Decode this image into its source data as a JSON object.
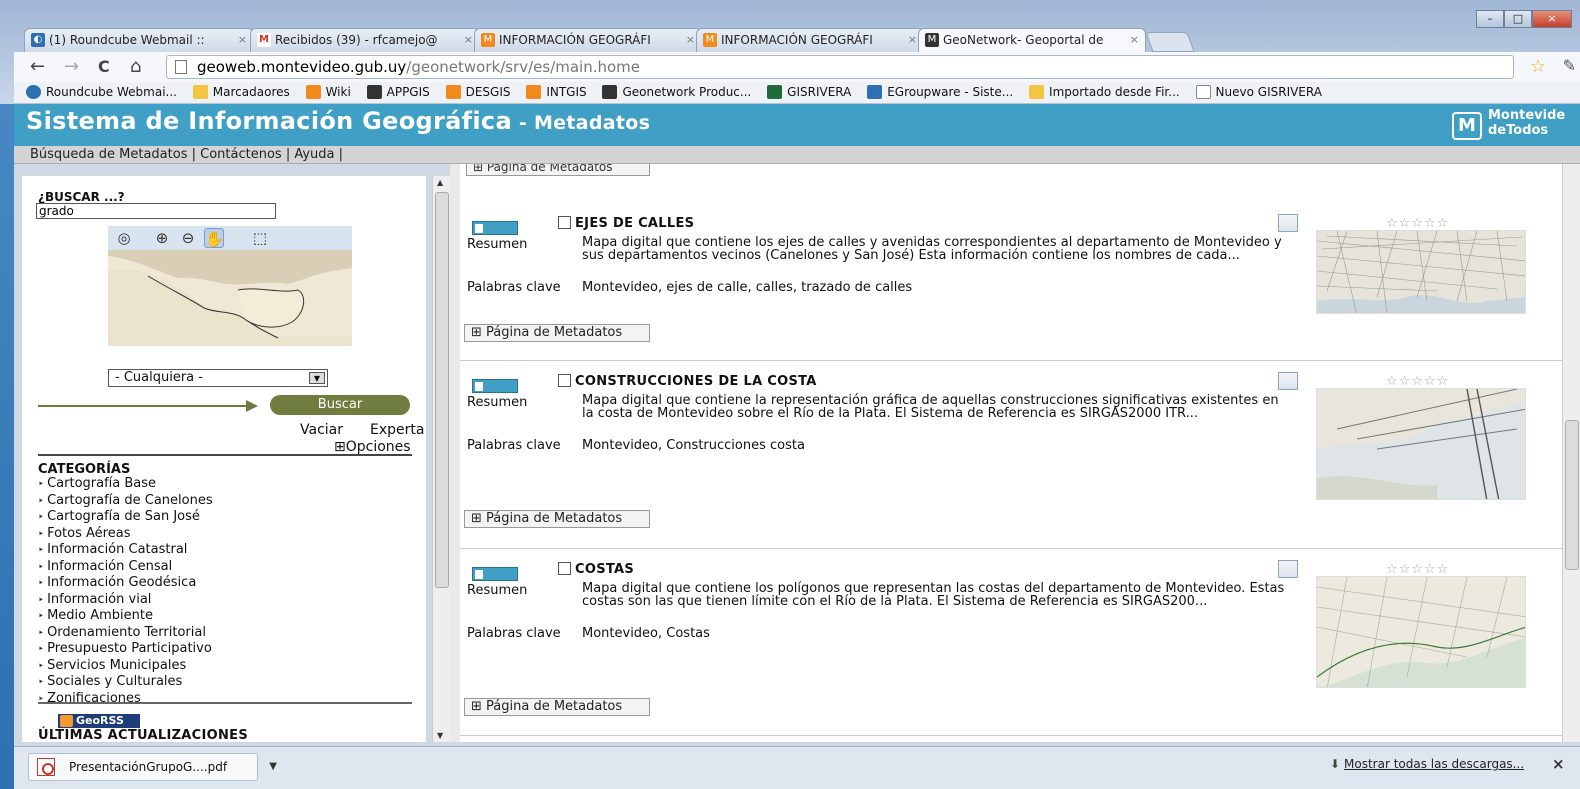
{
  "browser": {
    "tabs": [
      {
        "label": "(1) Roundcube Webmail ::",
        "close": "×",
        "fav_color": "#2d6fb0"
      },
      {
        "label": "Recibidos (39) - rfcamejo@",
        "close": "×",
        "fav_color": "#d93025"
      },
      {
        "label": "INFORMACIÓN GEOGRÁFI",
        "close": "×",
        "fav_color": "#f08a1c"
      },
      {
        "label": "INFORMACIÓN GEOGRÁFI",
        "close": "×",
        "fav_color": "#f08a1c"
      },
      {
        "label": "GeoNetwork- Geoportal de",
        "close": "×",
        "fav_color": "#333333"
      }
    ],
    "window_buttons": {
      "minimize": "–",
      "maximize": "□",
      "close": "×"
    },
    "nav": {
      "back": "←",
      "forward": "→",
      "reload": "C",
      "home": "⌂"
    },
    "url": {
      "host": "geoweb.montevideo.gub.uy",
      "path": "/geonetwork/srv/es/main.home"
    },
    "star": "☆",
    "wrench": "🔧",
    "bookmarks": [
      {
        "label": "Roundcube Webmai...",
        "color": "#2d6fb0"
      },
      {
        "label": "Marcadaores",
        "color": "#f4c542"
      },
      {
        "label": "Wiki",
        "color": "#f08a1c"
      },
      {
        "label": "APPGIS",
        "color": "#333333"
      },
      {
        "label": "DESGIS",
        "color": "#f08a1c"
      },
      {
        "label": "INTGIS",
        "color": "#f08a1c"
      },
      {
        "label": "Geonetwork Produc...",
        "color": "#333333"
      },
      {
        "label": "GISRIVERA",
        "color": "#1f6b3a"
      },
      {
        "label": "EGroupware - Siste...",
        "color": "#2d6fb0"
      },
      {
        "label": "Importado desde Fir...",
        "color": "#f4c542"
      },
      {
        "label": "Nuevo GISRIVERA",
        "color": "#ffffff"
      }
    ]
  },
  "site": {
    "title": "Sistema de Información Geográfica",
    "subtitle": " - Metadatos",
    "logo_letter": "M",
    "logo_text_1": "Montevide",
    "logo_text_2": "deTodos",
    "accent": "#3f9fc4",
    "menu": {
      "search": "Búsqueda de Metadatos",
      "contact": "Contáctenos",
      "help": "Ayuda",
      "sep": " | "
    }
  },
  "search": {
    "label": "¿BUSCAR ...?",
    "value": "grado",
    "category_select": "- Cualquiera -",
    "buscar": "Buscar",
    "vaciar": "Vaciar",
    "experta": "Experta",
    "opciones": "⊞Opciones",
    "button_color": "#6f7d3e"
  },
  "categories": {
    "title": "CATEGORÍAS",
    "items": [
      "Cartografía Base",
      "Cartografía de Canelones",
      "Cartografía de San José",
      "Fotos Aéreas",
      "Información Catastral",
      "Información Censal",
      "Información Geodésica",
      "Información vial",
      "Medio Ambiente",
      "Ordenamiento Territorial",
      "Presupuesto Participativo",
      "Servicios Municipales",
      "Sociales y Culturales",
      "Zonificaciones"
    ]
  },
  "updates": {
    "georss": "GeoRSS",
    "title": "ÚLTIMAS ACTUALIZACIONES"
  },
  "results": {
    "page_button": "⊞ Página de Metadatos",
    "summary_label": "Resumen",
    "keywords_label": "Palabras clave",
    "stars": "☆☆☆☆☆",
    "records": [
      {
        "title": "EJES DE CALLES",
        "summary": "Mapa digital que contiene los ejes de calles y avenidas correspondientes al departamento de Montevideo y sus departamentos vecinos (Canelones y San José) Esta información contiene los nombres de cada...",
        "keywords": "Montevideo, ejes de calle, calles, trazado de calles"
      },
      {
        "title": "CONSTRUCCIONES DE LA COSTA",
        "summary": "Mapa digital que contiene la representación gráfica de aquellas construcciones significativas existentes en la costa de Montevideo sobre el Río de la Plata. El Sistema de Referencia es SIRGAS2000 ITR...",
        "keywords": "Montevideo, Construcciones costa"
      },
      {
        "title": "COSTAS",
        "summary": "Mapa digital que contiene los polígonos que representan las costas del departamento de Montevideo. Estas costas son las que tienen límite con el Río de la Plata. El Sistema de Referencia es SIRGAS200...",
        "keywords": "Montevideo, Costas"
      }
    ]
  },
  "downloads": {
    "file": "PresentaciónGrupoG....pdf",
    "show_all": "Mostrar todas las descargas...",
    "close": "×"
  }
}
